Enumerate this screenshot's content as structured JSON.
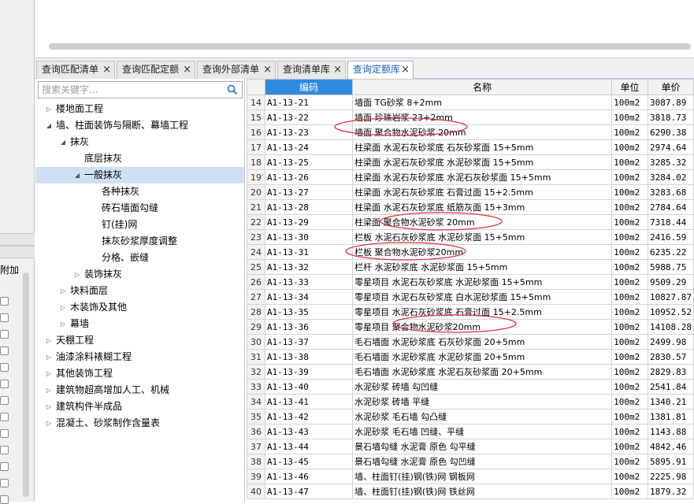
{
  "left_panel": {
    "add_label": "附加"
  },
  "tabs": [
    {
      "label": "查询匹配清单",
      "close": "×",
      "active": false
    },
    {
      "label": "查询匹配定额",
      "close": "×",
      "active": false
    },
    {
      "label": "查询外部清单",
      "close": "×",
      "active": false
    },
    {
      "label": "查询清单库",
      "close": "×",
      "active": false
    },
    {
      "label": "查询定额库",
      "close": "×",
      "active": true
    }
  ],
  "search": {
    "placeholder": "搜索关键字...",
    "icon": "search-icon"
  },
  "tree": [
    {
      "label": "楼地面工程",
      "level": 0,
      "toggle": "▷",
      "selected": false
    },
    {
      "label": "墙、柱面装饰与隔断、幕墙工程",
      "level": 0,
      "toggle": "◢",
      "selected": false
    },
    {
      "label": "抹灰",
      "level": 1,
      "toggle": "◢",
      "selected": false
    },
    {
      "label": "底层抹灰",
      "level": 2,
      "toggle": "",
      "selected": false
    },
    {
      "label": "一般抹灰",
      "level": 2,
      "toggle": "◢",
      "selected": true
    },
    {
      "label": "各种抹灰",
      "level": 3,
      "toggle": "",
      "selected": false
    },
    {
      "label": "砖石墙面勾缝",
      "level": 3,
      "toggle": "",
      "selected": false
    },
    {
      "label": "钉(挂)网",
      "level": 3,
      "toggle": "",
      "selected": false
    },
    {
      "label": "抹灰砂浆厚度调整",
      "level": 3,
      "toggle": "",
      "selected": false
    },
    {
      "label": "分格、嵌缝",
      "level": 3,
      "toggle": "",
      "selected": false
    },
    {
      "label": "装饰抹灰",
      "level": 2,
      "toggle": "▷",
      "selected": false
    },
    {
      "label": "块料面层",
      "level": 1,
      "toggle": "▷",
      "selected": false
    },
    {
      "label": "木装饰及其他",
      "level": 1,
      "toggle": "▷",
      "selected": false
    },
    {
      "label": "幕墙",
      "level": 1,
      "toggle": "▷",
      "selected": false
    },
    {
      "label": "天棚工程",
      "level": 0,
      "toggle": "▷",
      "selected": false
    },
    {
      "label": "油漆涂料裱糊工程",
      "level": 0,
      "toggle": "▷",
      "selected": false
    },
    {
      "label": "其他装饰工程",
      "level": 0,
      "toggle": "▷",
      "selected": false
    },
    {
      "label": "建筑物超高增加人工、机械",
      "level": 0,
      "toggle": "▷",
      "selected": false
    },
    {
      "label": "建筑构件半成品",
      "level": 0,
      "toggle": "▷",
      "selected": false
    },
    {
      "label": "混凝土、砂浆制作含量表",
      "level": 0,
      "toggle": "▷",
      "selected": false
    }
  ],
  "grid": {
    "headers": {
      "code": "编码",
      "name": "名称",
      "unit": "单位",
      "price": "单价"
    },
    "rows": [
      {
        "n": "14",
        "code": "A1-13-21",
        "name": "墙面 TG砂浆 8+2mm",
        "unit": "100m2",
        "price": "3087.89"
      },
      {
        "n": "15",
        "code": "A1-13-22",
        "name": "墙面 珍珠岩浆 23+2mm",
        "unit": "100m2",
        "price": "3818.73"
      },
      {
        "n": "16",
        "code": "A1-13-23",
        "name": "墙面 聚合物水泥砂浆 20mm",
        "unit": "100m2",
        "price": "6290.38"
      },
      {
        "n": "17",
        "code": "A1-13-24",
        "name": "柱梁面 水泥石灰砂浆底 石灰砂浆面 15+5mm",
        "unit": "100m2",
        "price": "2974.64"
      },
      {
        "n": "18",
        "code": "A1-13-25",
        "name": "柱梁面 水泥石灰砂浆底 水泥砂浆面 15+5mm",
        "unit": "100m2",
        "price": "3285.32"
      },
      {
        "n": "19",
        "code": "A1-13-26",
        "name": "柱梁面 水泥石灰砂浆底 水泥石灰砂浆面 15+5mm",
        "unit": "100m2",
        "price": "3284.02"
      },
      {
        "n": "20",
        "code": "A1-13-27",
        "name": "柱梁面 水泥石灰砂浆底 石膏过面 15+2.5mm",
        "unit": "100m2",
        "price": "3283.68"
      },
      {
        "n": "21",
        "code": "A1-13-28",
        "name": "柱梁面 水泥石灰砂浆底 纸筋灰面 15+3mm",
        "unit": "100m2",
        "price": "2784.64"
      },
      {
        "n": "22",
        "code": "A1-13-29",
        "name": "柱梁面 聚合物水泥砂浆 20mm",
        "unit": "100m2",
        "price": "7318.44"
      },
      {
        "n": "23",
        "code": "A1-13-30",
        "name": "栏板 水泥石灰砂浆底 水泥砂浆面 15+5mm",
        "unit": "100m2",
        "price": "2416.59"
      },
      {
        "n": "24",
        "code": "A1-13-31",
        "name": "栏板 聚合物水泥砂浆20mm",
        "unit": "100m2",
        "price": "6235.22"
      },
      {
        "n": "25",
        "code": "A1-13-32",
        "name": "栏杆 水泥砂浆底 水泥砂浆面 15+5mm",
        "unit": "100m2",
        "price": "5988.75"
      },
      {
        "n": "26",
        "code": "A1-13-33",
        "name": "零星项目 水泥石灰砂浆底 水泥砂浆面 15+5mm",
        "unit": "100m2",
        "price": "9509.29"
      },
      {
        "n": "27",
        "code": "A1-13-34",
        "name": "零星项目 水泥石灰砂浆底 白水泥砂浆面 15+5mm",
        "unit": "100m2",
        "price": "10827.87"
      },
      {
        "n": "28",
        "code": "A1-13-35",
        "name": "零星项目 水泥石灰砂浆底 石膏过面 15+2.5mm",
        "unit": "100m2",
        "price": "10952.52"
      },
      {
        "n": "29",
        "code": "A1-13-36",
        "name": "零星项目 聚合物水泥砂浆20mm",
        "unit": "100m2",
        "price": "14108.28"
      },
      {
        "n": "30",
        "code": "A1-13-37",
        "name": "毛石墙面 水泥砂浆底 石灰砂浆面 20+5mm",
        "unit": "100m2",
        "price": "2499.98"
      },
      {
        "n": "31",
        "code": "A1-13-38",
        "name": "毛石墙面 水泥砂浆底 水泥砂浆面 20+5mm",
        "unit": "100m2",
        "price": "2830.57"
      },
      {
        "n": "32",
        "code": "A1-13-39",
        "name": "毛石墙面 水泥砂浆底 水泥石灰砂浆面 20+5mm",
        "unit": "100m2",
        "price": "2829.83"
      },
      {
        "n": "33",
        "code": "A1-13-40",
        "name": "水泥砂浆 砖墙 勾凹缝",
        "unit": "100m2",
        "price": "2541.84"
      },
      {
        "n": "34",
        "code": "A1-13-41",
        "name": "水泥砂浆 砖墙 平缝",
        "unit": "100m2",
        "price": "1340.21"
      },
      {
        "n": "35",
        "code": "A1-13-42",
        "name": "水泥砂浆 毛石墙 勾凸缝",
        "unit": "100m2",
        "price": "1381.81"
      },
      {
        "n": "36",
        "code": "A1-13-43",
        "name": "水泥砂浆 毛石墙 凹缝、平缝",
        "unit": "100m2",
        "price": "1143.88"
      },
      {
        "n": "37",
        "code": "A1-13-44",
        "name": "景石墙勾缝 水泥膏 原色 勾平缝",
        "unit": "100m2",
        "price": "4842.46"
      },
      {
        "n": "38",
        "code": "A1-13-45",
        "name": "景石墙勾缝 水泥膏 原色 勾凹缝",
        "unit": "100m2",
        "price": "5895.91"
      },
      {
        "n": "39",
        "code": "A1-13-46",
        "name": "墙、柱面钉(挂)钢(铁)网 钢板网",
        "unit": "100m2",
        "price": "2225.98"
      },
      {
        "n": "40",
        "code": "A1-13-47",
        "name": "墙、柱面钉(挂)钢(铁)网 铁丝网",
        "unit": "100m2",
        "price": "1879.32"
      }
    ]
  },
  "annotation_color": "#d9363e"
}
